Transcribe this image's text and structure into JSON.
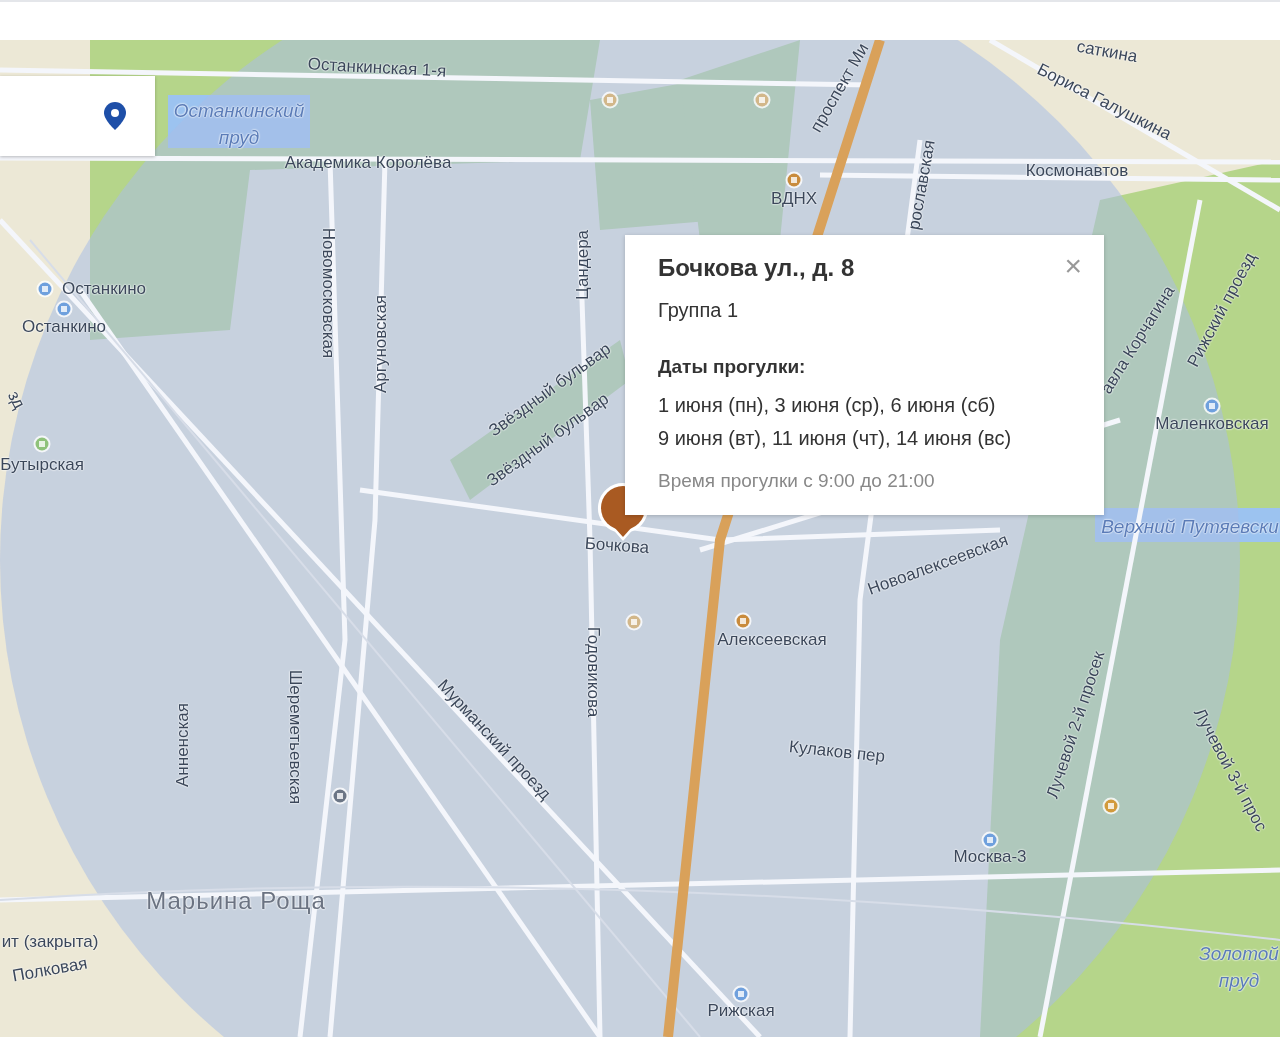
{
  "popup": {
    "close": "×",
    "title": "Бочкова ул., д. 8",
    "group": "Группа 1",
    "dates_heading": "Даты прогулки:",
    "dates": [
      "1 июня (пн), 3 июня (ср), 6 июня (сб)",
      "9 июня (вт), 11 июня (чт), 14 июня (вс)"
    ],
    "time_note": "Время прогулки с 9:00 до 21:00"
  },
  "map_labels": [
    {
      "text": "Останкинская 1-я",
      "kind": "street"
    },
    {
      "text": "Останкинский",
      "kind": "water"
    },
    {
      "text": "пруд",
      "kind": "water"
    },
    {
      "text": "Академика Королёва",
      "kind": "street"
    },
    {
      "text": "Новомосковская",
      "kind": "street"
    },
    {
      "text": "Аргуновская",
      "kind": "street"
    },
    {
      "text": "Цандера",
      "kind": "street"
    },
    {
      "text": "Останкино",
      "kind": "station"
    },
    {
      "text": "Останкино",
      "kind": "station"
    },
    {
      "text": "зд",
      "kind": "street"
    },
    {
      "text": "Бутырская",
      "kind": "station"
    },
    {
      "text": "Звёздный бульвар",
      "kind": "street"
    },
    {
      "text": "Звёздный бульвар",
      "kind": "street"
    },
    {
      "text": "проспект Ми",
      "kind": "street"
    },
    {
      "text": "ВДНХ",
      "kind": "station"
    },
    {
      "text": "рославская",
      "kind": "street"
    },
    {
      "text": "Космонавтов",
      "kind": "street"
    },
    {
      "text": "саткина",
      "kind": "street"
    },
    {
      "text": "Бориса Галушкина",
      "kind": "street"
    },
    {
      "text": "авла Корчагина",
      "kind": "street"
    },
    {
      "text": "Рижский проезд",
      "kind": "street"
    },
    {
      "text": "Маленковская",
      "kind": "station"
    },
    {
      "text": "Верхний Путяевски",
      "kind": "water"
    },
    {
      "text": "Бочкова",
      "kind": "street"
    },
    {
      "text": "Новоалексеевская",
      "kind": "street"
    },
    {
      "text": "Алексеевская",
      "kind": "station"
    },
    {
      "text": "Годовикова",
      "kind": "street"
    },
    {
      "text": "Мурманский проезд",
      "kind": "street"
    },
    {
      "text": "Анненская",
      "kind": "street"
    },
    {
      "text": "Шереметьевская",
      "kind": "street"
    },
    {
      "text": "Кулаков пер",
      "kind": "street"
    },
    {
      "text": "Лучевой 2-й просек",
      "kind": "street"
    },
    {
      "text": "Лучевой 3-й прос",
      "kind": "street"
    },
    {
      "text": "Москва-3",
      "kind": "station"
    },
    {
      "text": "Марьина Роща",
      "kind": "district"
    },
    {
      "text": "ит (закрыта)",
      "kind": "street"
    },
    {
      "text": "Полковая",
      "kind": "street"
    },
    {
      "text": "Золотой",
      "kind": "water"
    },
    {
      "text": "пруд",
      "kind": "water"
    },
    {
      "text": "Рижская",
      "kind": "station"
    }
  ]
}
